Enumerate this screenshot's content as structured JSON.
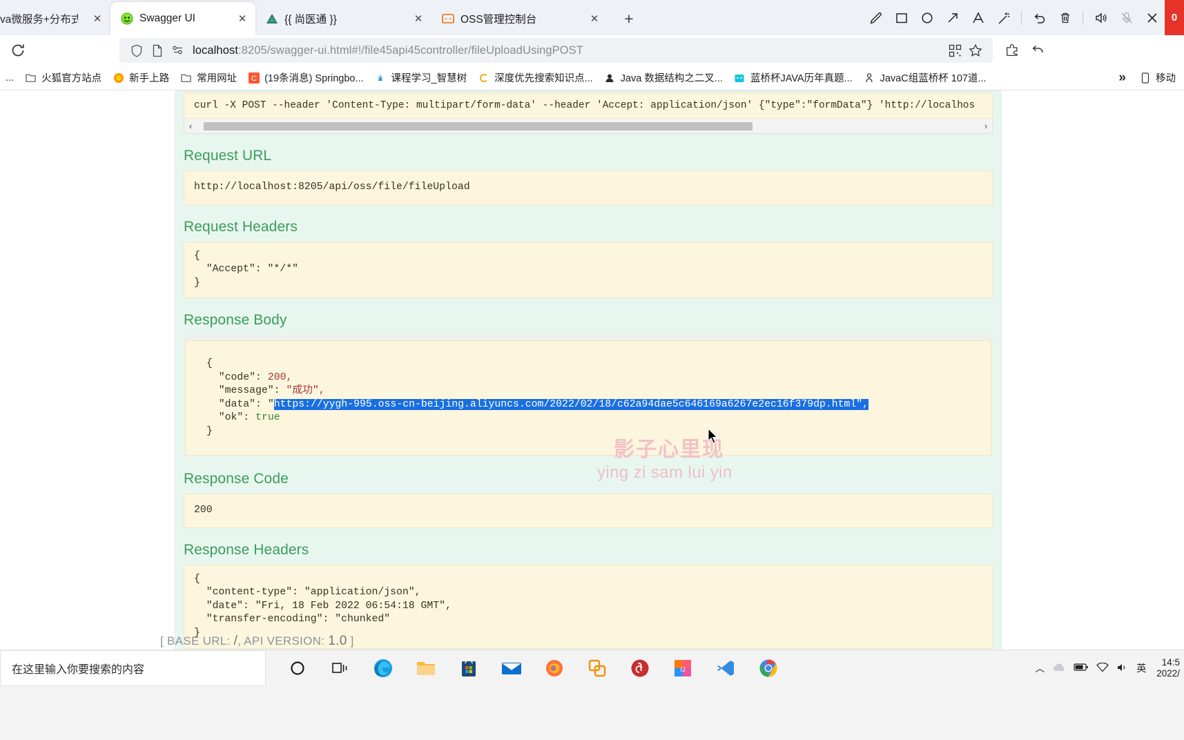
{
  "browser": {
    "tabs": [
      {
        "title": "va微服务+分布式+全栈",
        "favicon": "",
        "active": false,
        "close_label": "✕"
      },
      {
        "title": "Swagger UI",
        "favicon": "swagger-icon",
        "active": true,
        "close_label": "✕"
      },
      {
        "title": "{{ 尚医通 }}",
        "favicon": "vue-triangle-icon",
        "active": false,
        "close_label": "✕"
      },
      {
        "title": "OSS管理控制台",
        "favicon": "oss-icon",
        "active": false,
        "close_label": "✕"
      }
    ],
    "new_tab_label": "+",
    "url": {
      "host": "localhost",
      "path": ":8205/swagger-ui.html#!/file45api45controller/fileUploadUsingPOST",
      "full": "localhost:8205/swagger-ui.html#!/file45api45controller/fileUploadUsingPOST"
    },
    "reload_label": "⟳",
    "bookmarks": [
      {
        "label": "...",
        "icon": "folder-icon"
      },
      {
        "label": "火狐官方站点",
        "icon": "folder-icon"
      },
      {
        "label": "新手上路",
        "icon": "firefox-icon"
      },
      {
        "label": "常用网址",
        "icon": "folder-icon"
      },
      {
        "label": "(19条消息) Springbo...",
        "icon": "csdn-icon"
      },
      {
        "label": "课程学习_智慧树",
        "icon": "zhihuishu-icon"
      },
      {
        "label": "深度优先搜索知识点...",
        "icon": "c-icon"
      },
      {
        "label": "Java 数据结构之二叉...",
        "icon": "avatar-icon"
      },
      {
        "label": "蓝桥杯JAVA历年真题...",
        "icon": "lanqiao-icon"
      },
      {
        "label": "JavaC组蓝桥杯 107道...",
        "icon": "person-icon"
      }
    ],
    "bookmark_overflow_label": "»",
    "mobile_label": "移动"
  },
  "annotation_toolbar": {
    "tools": [
      {
        "name": "pen-icon",
        "label": "铅笔"
      },
      {
        "name": "rectangle-icon",
        "label": "矩形"
      },
      {
        "name": "ellipse-icon",
        "label": "椭圆"
      },
      {
        "name": "arrow-icon",
        "label": "箭头"
      },
      {
        "name": "text-icon",
        "label": "文字"
      },
      {
        "name": "magic-wand-icon",
        "label": "魔术棒"
      },
      {
        "name": "undo-icon",
        "label": "撤销"
      },
      {
        "name": "trash-icon",
        "label": "删除"
      },
      {
        "name": "speaker-icon",
        "label": "扬声器"
      },
      {
        "name": "mic-muted-icon",
        "label": "麦克风已静音"
      },
      {
        "name": "close-icon",
        "label": "关闭"
      }
    ],
    "record_badge": "0"
  },
  "swagger": {
    "curl_command": "curl -X POST --header 'Content-Type: multipart/form-data' --header 'Accept: application/json' {\"type\":\"formData\"} 'http://localhos",
    "sections": {
      "request_url_title": "Request URL",
      "request_url_value": "http://localhost:8205/api/oss/file/fileUpload",
      "request_headers_title": "Request Headers",
      "request_headers_value": "{\n  \"Accept\": \"*/*\"\n}",
      "response_body_title": "Response Body",
      "response_body": {
        "open_brace": "{",
        "code_key": "\"code\":",
        "code_value": "200,",
        "message_key": "\"message\":",
        "message_value": "\"成功\",",
        "data_key": "\"data\":",
        "data_quote": "\"",
        "data_value_selected": "https://yygh-995.oss-cn-beijing.aliyuncs.com/2022/02/18/c62a94dae5c646169a6267e2ec16f379dp.html\",",
        "ok_key": "\"ok\":",
        "ok_value": "true",
        "close_brace": "}"
      },
      "response_code_title": "Response Code",
      "response_code_value": "200",
      "response_headers_title": "Response Headers",
      "response_headers_value": "{\n  \"content-type\": \"application/json\",\n  \"date\": \"Fri, 18 Feb 2022 06:54:18 GMT\",\n  \"transfer-encoding\": \"chunked\"\n}"
    },
    "footer": {
      "prefix": "[ BASE URL: ",
      "base_url": "/",
      "middle": ", API VERSION: ",
      "api_version": "1.0",
      "suffix": " ]"
    }
  },
  "watermark": {
    "line1": "影子心里现",
    "line2": "ying zi sam lui yin"
  },
  "taskbar": {
    "search_placeholder": "在这里输入你要搜索的内容",
    "icons": [
      {
        "name": "cortana-icon",
        "label": "Cortana"
      },
      {
        "name": "task-view-icon",
        "label": "任务视图"
      },
      {
        "name": "edge-icon",
        "label": "Microsoft Edge"
      },
      {
        "name": "file-explorer-icon",
        "label": "文件资源管理器"
      },
      {
        "name": "microsoft-store-icon",
        "label": "Microsoft Store"
      },
      {
        "name": "mail-icon",
        "label": "邮件"
      },
      {
        "name": "firefox-icon",
        "label": "Firefox"
      },
      {
        "name": "vmware-icon",
        "label": "VMware"
      },
      {
        "name": "netease-music-icon",
        "label": "网易云音乐"
      },
      {
        "name": "intellij-idea-icon",
        "label": "IntelliJ IDEA"
      },
      {
        "name": "vscode-icon",
        "label": "Visual Studio Code"
      },
      {
        "name": "chrome-icon",
        "label": "Chrome"
      }
    ],
    "tray": {
      "chevron": "︿",
      "ime_label": "英",
      "time": "14:5",
      "date": "2022/"
    }
  },
  "colors": {
    "swagger_green": "#3b9c5a",
    "panel_bg": "#e8f6f0",
    "code_bg": "#fcf6df",
    "selection_blue": "#1a6fe0",
    "watermark_pink": "#f3b7c0",
    "record_red": "#e63329"
  }
}
